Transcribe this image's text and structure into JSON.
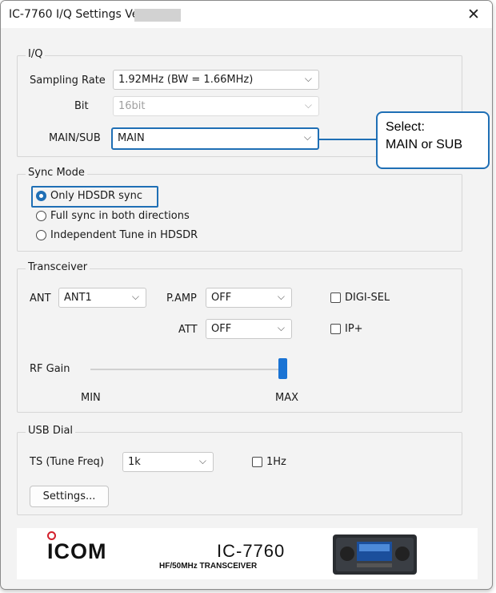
{
  "window": {
    "title": "IC-7760 I/Q Settings   Ver",
    "close_glyph": "✕"
  },
  "iq": {
    "legend": "I/Q",
    "sampling_rate_label": "Sampling Rate",
    "sampling_rate_value": "1.92MHz (BW = 1.66MHz)",
    "bit_label": "Bit",
    "bit_value": "16bit",
    "main_sub_label": "MAIN/SUB",
    "main_sub_value": "MAIN"
  },
  "callout": {
    "line1": "Select:",
    "line2": "MAIN or SUB",
    "color": "#1f6fb5"
  },
  "sync_mode": {
    "legend": "Sync Mode",
    "options": [
      {
        "label": "Only HDSDR sync",
        "selected": true
      },
      {
        "label": "Full sync in both directions",
        "selected": false
      },
      {
        "label": "Independent Tune in HDSDR",
        "selected": false
      }
    ]
  },
  "transceiver": {
    "legend": "Transceiver",
    "ant_label": "ANT",
    "ant_value": "ANT1",
    "pamp_label": "P.AMP",
    "pamp_value": "OFF",
    "att_label": "ATT",
    "att_value": "OFF",
    "digisel_label": "DIGI-SEL",
    "ipplus_label": "IP+",
    "rf_gain_label": "RF Gain",
    "rf_gain_level": 1.0,
    "min_label": "MIN",
    "max_label": "MAX"
  },
  "usb_dial": {
    "legend": "USB Dial",
    "ts_label": "TS (Tune Freq)",
    "ts_value": "1k",
    "onehz_label": "1Hz",
    "settings_button": "Settings..."
  },
  "banner": {
    "brand": "ICOM",
    "model": "IC-7760",
    "model_sub": "HF/50MHz TRANSCEIVER"
  },
  "icons": {
    "dropdown": "chevron-down-icon"
  },
  "colors": {
    "accent": "#1f6fb5",
    "slider": "#1a73d4",
    "logo_red": "#d3202c"
  }
}
